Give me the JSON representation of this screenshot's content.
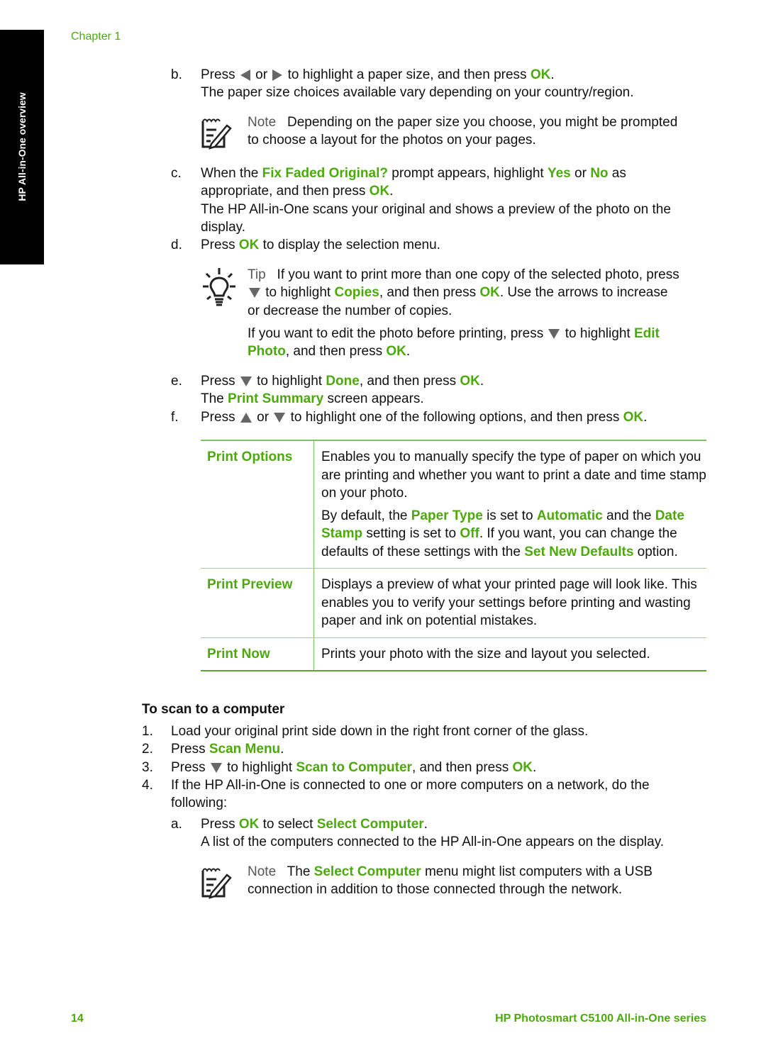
{
  "side_tab": "HP All-in-One overview",
  "chapter": "Chapter 1",
  "colors": {
    "accent": "#4ca90c",
    "text": "#111111",
    "arrow": "#666666"
  },
  "step_b": {
    "letter": "b.",
    "l1_pre": "Press",
    "l1_or": "or",
    "l1_post": "to highlight a paper size, and then press",
    "ok": "OK",
    "dot": ".",
    "l2": "The paper size choices available vary depending on your country/region."
  },
  "note1": {
    "label": "Note",
    "l1": "Depending on the paper size you choose, you might be prompted",
    "l2": "to choose a layout for the photos on your pages."
  },
  "step_c": {
    "letter": "c.",
    "pre": "When the",
    "fix": "Fix Faded Original?",
    "mid": "prompt appears, highlight",
    "yes": "Yes",
    "or": "or",
    "no": "No",
    "as": "as",
    "l2_pre": "appropriate, and then press",
    "ok": "OK",
    "dot": ".",
    "l3": "The HP All-in-One scans your original and shows a preview of the photo on the",
    "l4": "display."
  },
  "step_d": {
    "letter": "d.",
    "pre": "Press",
    "ok": "OK",
    "post": "to display the selection menu."
  },
  "tip": {
    "label": "Tip",
    "l1": "If you want to print more than one copy of the selected photo, press",
    "l2_pre": "to highlight",
    "copies": "Copies",
    "l2_mid": ", and then press",
    "ok": "OK",
    "l2_post": ". Use the arrows to increase",
    "l3": "or decrease the number of copies.",
    "p2_l1_pre": "If you want to edit the photo before printing, press",
    "p2_l1_mid": "to highlight",
    "edit": "Edit",
    "photo": "Photo",
    "p2_l2_mid": ", and then press",
    "dot": "."
  },
  "step_e": {
    "letter": "e.",
    "pre": "Press",
    "mid": "to highlight",
    "done": "Done",
    "mid2": ", and then press",
    "ok": "OK",
    "dot": ".",
    "l2_pre": "The",
    "summary": "Print Summary",
    "l2_post": "screen appears."
  },
  "step_f": {
    "letter": "f.",
    "pre": "Press",
    "or": "or",
    "post": "to highlight one of the following options, and then press",
    "ok": "OK",
    "dot": "."
  },
  "options_table": [
    {
      "name": "Print Options",
      "p1": "Enables you to manually specify the type of paper on which you are printing and whether you want to print a date and time stamp on your photo.",
      "p2": {
        "a": "By default, the",
        "paper_type": "Paper Type",
        "b": "is set to",
        "automatic": "Automatic",
        "c": "and the",
        "date_stamp": "Date Stamp",
        "d": "setting is set to",
        "off": "Off",
        "e": ". If you want, you can change the defaults of these settings with the",
        "set_new": "Set New Defaults",
        "f": "option."
      }
    },
    {
      "name": "Print Preview",
      "p1": "Displays a preview of what your printed page will look like. This enables you to verify your settings before printing and wasting paper and ink on potential mistakes."
    },
    {
      "name": "Print Now",
      "p1": "Prints your photo with the size and layout you selected."
    }
  ],
  "scan": {
    "heading": "To scan to a computer",
    "s1": {
      "num": "1.",
      "text": "Load your original print side down in the right front corner of the glass."
    },
    "s2": {
      "num": "2.",
      "pre": "Press",
      "menu": "Scan Menu",
      "dot": "."
    },
    "s3": {
      "num": "3.",
      "pre": "Press",
      "mid": "to highlight",
      "target": "Scan to Computer",
      "mid2": ", and then press",
      "ok": "OK",
      "dot": "."
    },
    "s4": {
      "num": "4.",
      "l1": "If the HP All-in-One is connected to one or more computers on a network, do the",
      "l2": "following:"
    },
    "sa": {
      "letter": "a.",
      "pre": "Press",
      "ok": "OK",
      "mid": "to select",
      "target": "Select Computer",
      "dot": ".",
      "l2": "A list of the computers connected to the HP All-in-One appears on the display."
    },
    "note": {
      "label": "Note",
      "pre": "The",
      "target": "Select Computer",
      "post": "menu might list computers with a USB",
      "l2": "connection in addition to those connected through the network."
    }
  },
  "footer": {
    "page": "14",
    "product": "HP Photosmart C5100 All-in-One series"
  }
}
